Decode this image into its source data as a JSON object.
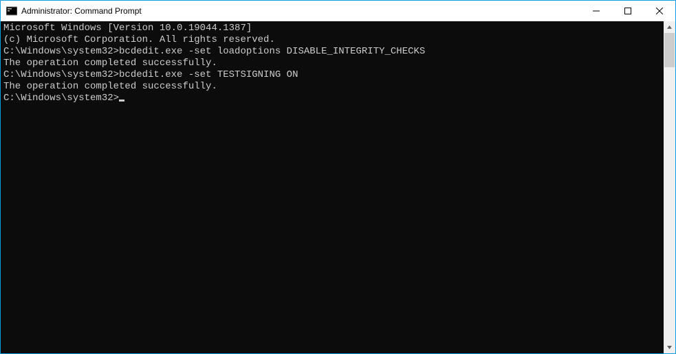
{
  "window": {
    "title": "Administrator: Command Prompt",
    "accent_color": "#0a9ee0"
  },
  "controls": {
    "minimize_label": "Minimize",
    "maximize_label": "Maximize",
    "close_label": "Close"
  },
  "terminal": {
    "lines": [
      "Microsoft Windows [Version 10.0.19044.1387]",
      "(c) Microsoft Corporation. All rights reserved.",
      "",
      "C:\\Windows\\system32>bcdedit.exe -set loadoptions DISABLE_INTEGRITY_CHECKS",
      "The operation completed successfully.",
      "",
      "C:\\Windows\\system32>bcdedit.exe -set TESTSIGNING ON",
      "The operation completed successfully.",
      "",
      "C:\\Windows\\system32>"
    ],
    "cursor_on_last_line": true
  }
}
